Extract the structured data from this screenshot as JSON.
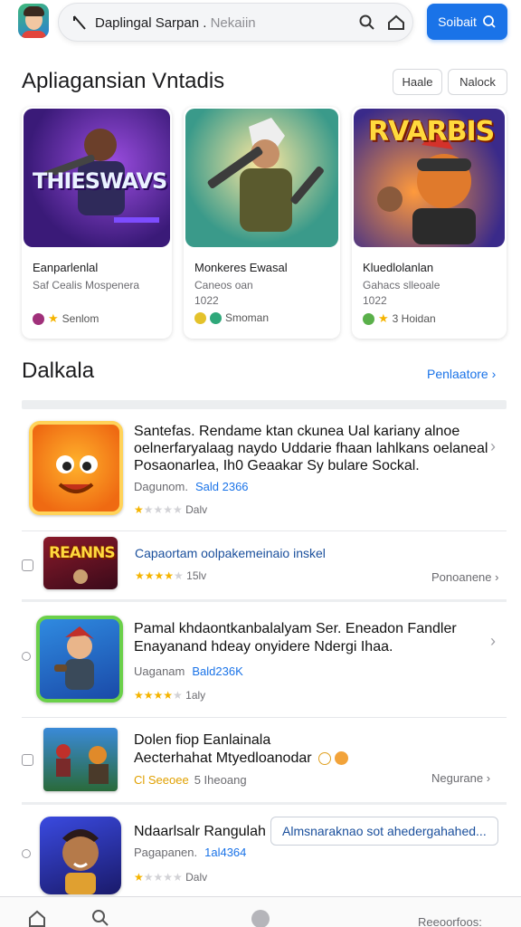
{
  "search": {
    "query": "Daplingal Sarpan .",
    "hint": "Nekaiin",
    "button_label": "Soibait"
  },
  "section1": {
    "title": "Apliagansian Vntadis",
    "chips": [
      "Haale",
      "Nalock"
    ],
    "cards": [
      {
        "art_text": "THIESWAVS",
        "name": "Eanparlenlal",
        "sub": "Saf Cealis Mospenera",
        "sub2": "",
        "meta": "Senlom"
      },
      {
        "art_text": "",
        "name": "Monkeres Ewasal",
        "sub": "Caneos oan",
        "sub2": "1022",
        "meta": "Smoman"
      },
      {
        "art_text": "RVARBIS",
        "name": "Kluedlolanlan",
        "sub": "Gahacs slleoale",
        "sub2": "1022",
        "meta": "3 Hoidan"
      }
    ]
  },
  "section2": {
    "title": "Dalkala",
    "link": "Penlaatore ›",
    "rows": [
      {
        "lines": [
          "Santefas. Rendame ktan ckunea Ual kariany alnoe",
          "oelnerfaryalaag naydo Uddarie fhaan lahlkans oelaneal",
          "Posaonarlea, Ih0 Geaakar Sy bulare Sockal."
        ],
        "meta_label": "Dagunom.",
        "meta_value": "Sald 2366",
        "stars": 1,
        "rating_text": "Dalv"
      },
      {
        "lines": [
          "Capaortam oolpakemeinaio inskel"
        ],
        "icon_text": "REANNS",
        "stars": 4,
        "rating_text": "15lv",
        "right": "Ponoanene ›"
      },
      {
        "lines": [
          "Pamal khdaontkanbalalyam Ser. Eneadon Fandler",
          "Enayanand hdeay onyidere Ndergi Ihaa."
        ],
        "meta_label": "Uaganam",
        "meta_value": "Bald236K",
        "stars": 4,
        "rating_text": "1aly"
      },
      {
        "lines": [
          "Dolen fiop Eanlainala",
          "Aecterhahat Mtyedloanodar"
        ],
        "meta_label": "Cl Seeoee",
        "meta_value": "5 Iheoang",
        "right": "Negurane ›"
      },
      {
        "lines": [
          "Ndaarlsalr Rangulah"
        ],
        "pill": "Almsnaraknao sot ahedergahahed...",
        "meta_label": "Pagapanen.",
        "meta_value": "1al4364",
        "stars": 1,
        "rating_text": "Dalv"
      }
    ]
  },
  "bottom_nav": {
    "label": "Reeoorfoos:"
  },
  "colors": {
    "accent": "#1a73e8",
    "star": "#f5b400"
  }
}
